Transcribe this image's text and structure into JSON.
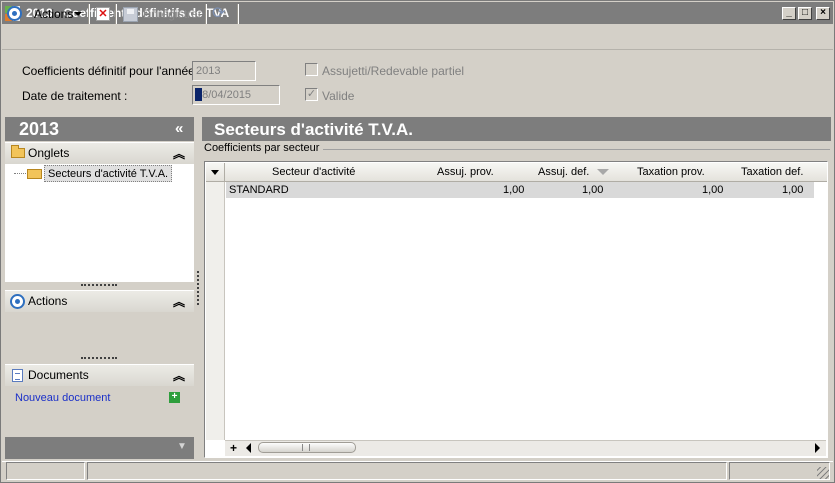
{
  "window": {
    "title": "2013 -  Coefficients définitifs de TVA"
  },
  "toolbar": {
    "actions_label": "Actions",
    "save_label": "Enregistrer"
  },
  "form": {
    "year_label": "Coefficients définitif pour l'année :",
    "year_value": "2013",
    "date_label": "Date de traitement :",
    "date_value": "18/04/2015",
    "assujetti_label": "Assujetti/Redevable partiel",
    "assujetti_checked": false,
    "valide_label": "Valide",
    "valide_checked": true
  },
  "left_panel": {
    "title": "2013",
    "collapse_glyph": "«",
    "sections": {
      "onglets": {
        "title": "Onglets",
        "items": [
          "Secteurs d'activité T.V.A."
        ]
      },
      "actions": {
        "title": "Actions"
      },
      "documents": {
        "title": "Documents",
        "new_document": "Nouveau document"
      }
    }
  },
  "main": {
    "title": "Secteurs d'activité T.V.A.",
    "group_label": "Coefficients par secteur",
    "grid": {
      "columns": [
        "Secteur d'activité",
        "Assuj. prov.",
        "Assuj. def.",
        "Taxation prov.",
        "Taxation def."
      ],
      "rows": [
        {
          "secteur": "STANDARD",
          "assuj_prov": "1,00",
          "assuj_def": "1,00",
          "taxation_prov": "1,00",
          "taxation_def": "1,00"
        }
      ]
    }
  },
  "colors": {
    "header_gray": "#7d7d7d",
    "window_bg": "#d4d0c8",
    "link_blue": "#1a2fc8"
  },
  "icons": [
    "app-logo-icon",
    "actions-icon",
    "delete-icon",
    "save-icon",
    "refresh-icon",
    "folder-icon",
    "document-icon",
    "add-icon",
    "sort-icon"
  ]
}
